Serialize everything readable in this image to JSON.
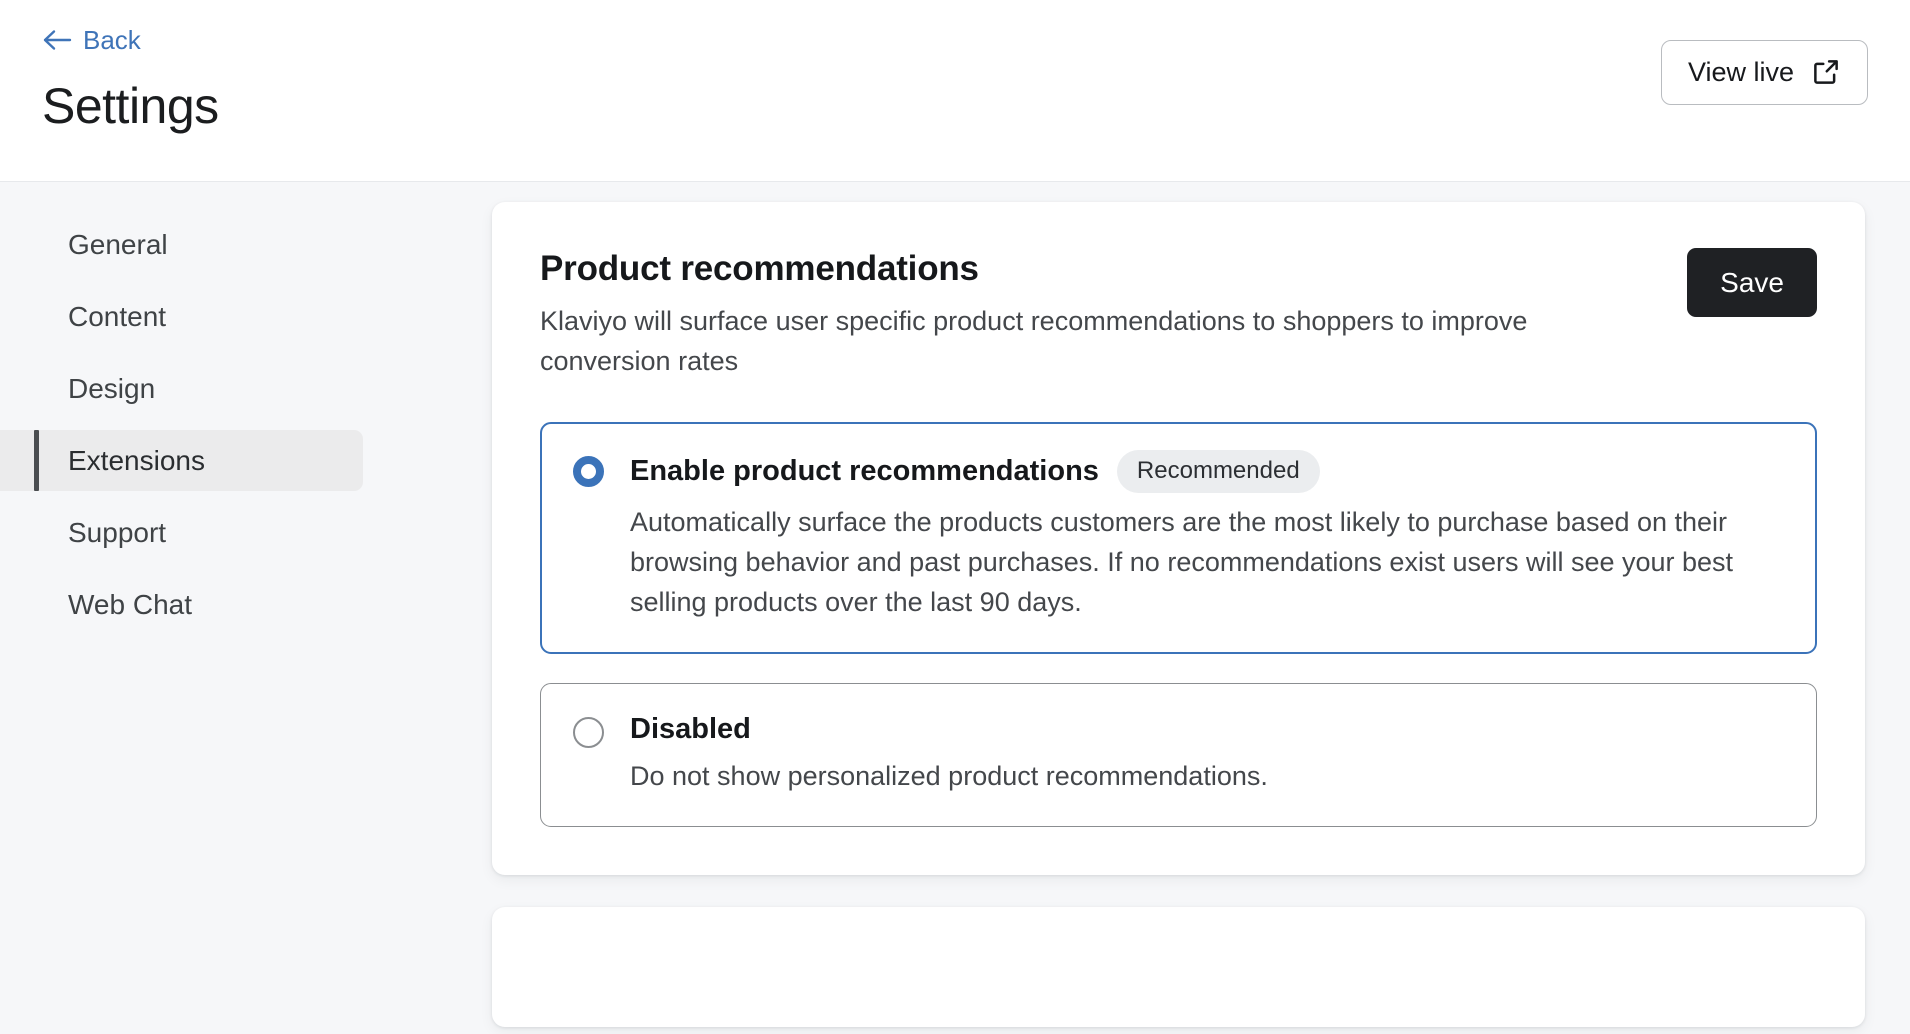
{
  "header": {
    "back_label": "Back",
    "back_icon": "arrow-left-icon",
    "title": "Settings",
    "view_live_label": "View live",
    "view_live_icon": "external-link-icon"
  },
  "sidebar": {
    "items": [
      {
        "label": "General",
        "active": false
      },
      {
        "label": "Content",
        "active": false
      },
      {
        "label": "Design",
        "active": false
      },
      {
        "label": "Extensions",
        "active": true
      },
      {
        "label": "Support",
        "active": false
      },
      {
        "label": "Web Chat",
        "active": false
      }
    ]
  },
  "main": {
    "card": {
      "title": "Product recommendations",
      "description": "Klaviyo will surface user specific product recommendations to shoppers to improve conversion rates",
      "save_label": "Save",
      "options": [
        {
          "title": "Enable product recommendations",
          "badge": "Recommended",
          "description": "Automatically surface the products customers are the most likely to purchase based on their browsing behavior and past purchases. If no recommendations exist users will see your best selling products over the last 90 days.",
          "selected": true
        },
        {
          "title": "Disabled",
          "badge": "",
          "description": "Do not show personalized product recommendations.",
          "selected": false
        }
      ]
    }
  },
  "colors": {
    "accent_blue": "#3b73b9",
    "link_blue": "#3f74b8",
    "save_dark": "#1f2124",
    "page_bg": "#f6f7f9",
    "badge_bg": "#ebedef",
    "active_nav_bg": "#ebebec",
    "active_nav_bar": "#4a4d50"
  }
}
